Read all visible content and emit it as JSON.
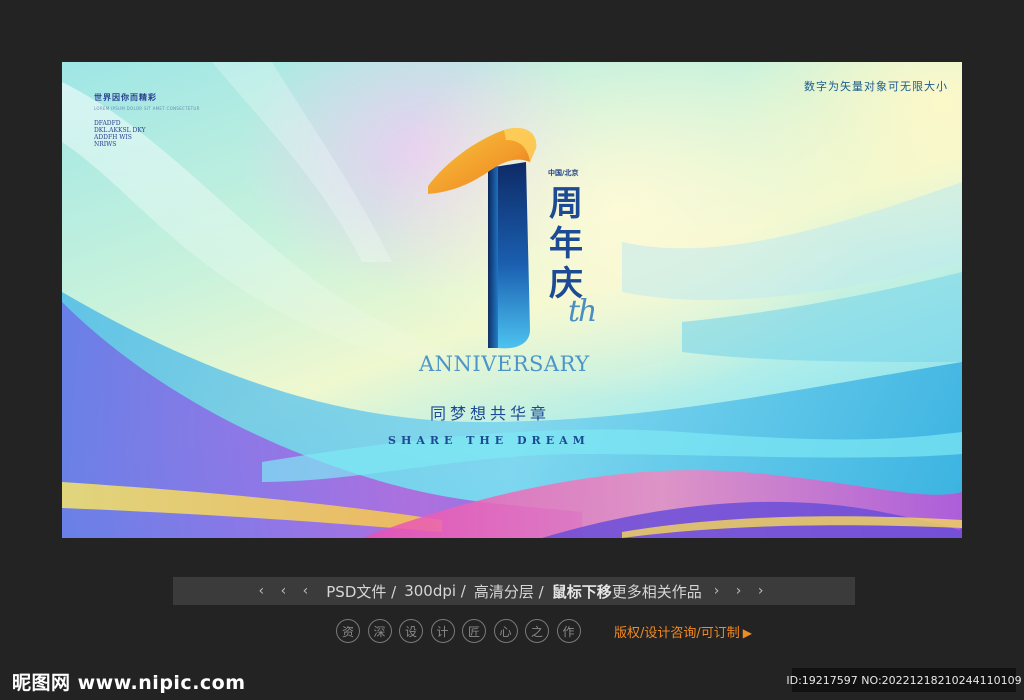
{
  "poster": {
    "corner_title": "世界因你而精彩",
    "corner_subtitle": "LOREM IPSUM DOLOR SIT AMET CONSECTETUR",
    "corner_codes": [
      "DFADFD",
      "DKL.AKKSL DKY",
      "ADDFH WIS",
      "NRIWS"
    ],
    "vector_note": "数字为矢量对象可无限大小",
    "location": "中国/北京",
    "anniversary_cn": "周年庆",
    "ordinal_suffix": "th",
    "anniversary_en": "ANNIVERSARY",
    "slogan_cn": "同梦想共华章",
    "slogan_en": "SHARE THE DREAM",
    "number_color_top": "#f0a030",
    "number_color_body": "#123f86",
    "title_color": "#1c4a94"
  },
  "toolbar": {
    "left_arrows": "‹ ‹ ‹",
    "file_type": "PSD文件 /",
    "resolution": "300dpi /",
    "layers": "高清分层 /",
    "hover_hint_bold": "鼠标下移",
    "hover_hint_rest": "更多相关作品",
    "right_arrows": "› › ›"
  },
  "services": {
    "chars": [
      "资",
      "深",
      "设",
      "计",
      "匠",
      "心",
      "之",
      "作"
    ],
    "copyright_link": "版权/设计咨询/可订制",
    "accent_color": "#f08a22"
  },
  "footer": {
    "logo": "昵图网 www.nipic.com",
    "id_info": "ID:19217597 NO:20221218210244110109"
  }
}
